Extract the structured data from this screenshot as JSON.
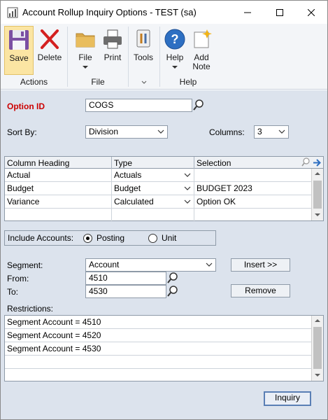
{
  "window": {
    "title": "Account Rollup Inquiry Options  -  TEST (sa)"
  },
  "ribbon": {
    "buttons": {
      "save": "Save",
      "delete": "Delete",
      "file": "File",
      "print": "Print",
      "tools": "Tools",
      "help": "Help",
      "add_note_line1": "Add",
      "add_note_line2": "Note"
    },
    "groups": {
      "actions": "Actions",
      "file": "File",
      "help": "Help"
    }
  },
  "form": {
    "option_id_label": "Option ID",
    "option_id_value": "COGS",
    "sort_by_label": "Sort By:",
    "sort_by_value": "Division",
    "columns_label": "Columns:",
    "columns_value": "3"
  },
  "grid": {
    "headers": {
      "column_heading": "Column Heading",
      "type": "Type",
      "selection": "Selection"
    },
    "rows": [
      {
        "heading": "Actual",
        "type": "Actuals",
        "selection": ""
      },
      {
        "heading": "Budget",
        "type": "Budget",
        "selection": "BUDGET 2023"
      },
      {
        "heading": "Variance",
        "type": "Calculated",
        "selection": "Option OK"
      }
    ]
  },
  "include_accounts": {
    "label": "Include Accounts:",
    "posting": "Posting",
    "unit": "Unit",
    "selected": "Posting"
  },
  "segment": {
    "label": "Segment:",
    "value": "Account",
    "from_label": "From:",
    "from_value": "4510",
    "to_label": "To:",
    "to_value": "4530",
    "insert_button": "Insert >>",
    "remove_button": "Remove"
  },
  "restrictions": {
    "label": "Restrictions:",
    "items": [
      "Segment Account = 4510",
      "Segment Account = 4520",
      "Segment Account = 4530"
    ]
  },
  "footer": {
    "inquiry_button": "Inquiry"
  },
  "colors": {
    "required_label": "#cc0000",
    "form_bg": "#dce3ed",
    "ribbon_active": "#fbe5a3"
  }
}
